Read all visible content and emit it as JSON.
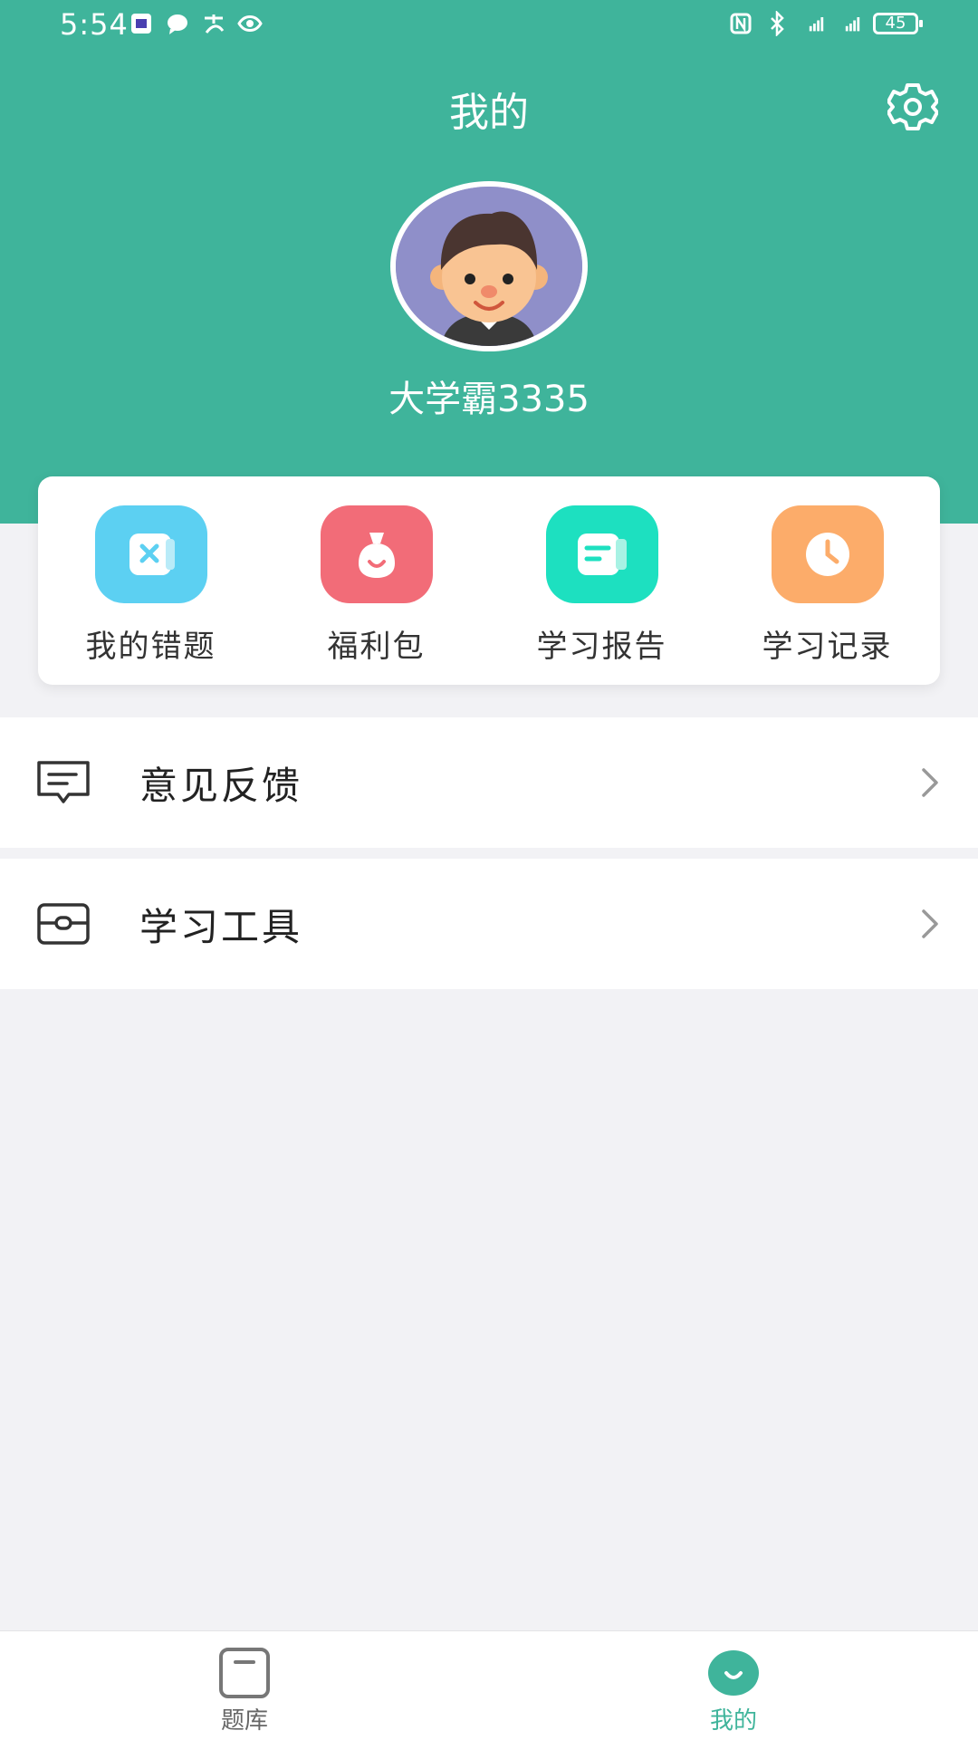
{
  "status_bar": {
    "time": "5:54",
    "battery": "45"
  },
  "header": {
    "title": "我的",
    "username": "大学霸3335"
  },
  "quick_actions": [
    {
      "label": "我的错题",
      "icon": "wrong-questions-icon",
      "color": "#5cd0f2"
    },
    {
      "label": "福利包",
      "icon": "gift-bag-icon",
      "color": "#f26c78"
    },
    {
      "label": "学习报告",
      "icon": "report-icon",
      "color": "#1de0c0"
    },
    {
      "label": "学习记录",
      "icon": "clock-icon",
      "color": "#fcac6a"
    }
  ],
  "menu": [
    {
      "label": "意见反馈",
      "icon": "feedback-icon"
    },
    {
      "label": "学习工具",
      "icon": "toolbox-icon"
    }
  ],
  "tabbar": {
    "items": [
      {
        "label": "题库",
        "icon": "question-bank-icon",
        "active": false
      },
      {
        "label": "我的",
        "icon": "profile-icon",
        "active": true
      }
    ],
    "active_color": "#3fb49b",
    "inactive_color": "#666666"
  },
  "theme": {
    "primary": "#3fb49b"
  }
}
